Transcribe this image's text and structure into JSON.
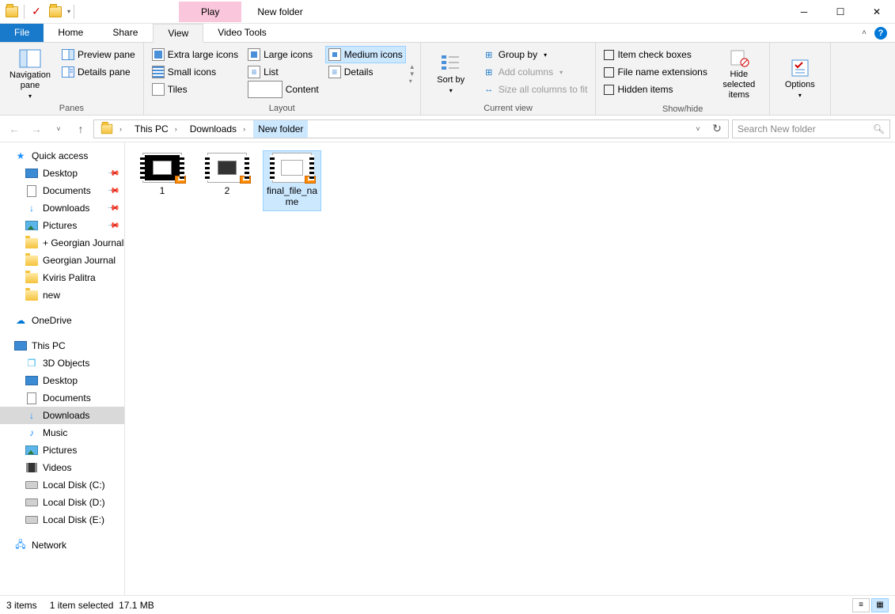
{
  "title": "New folder",
  "context_tab": "Play",
  "tabs": {
    "file": "File",
    "home": "Home",
    "share": "Share",
    "view": "View",
    "video": "Video Tools"
  },
  "ribbon": {
    "panes": {
      "nav": "Navigation pane",
      "preview": "Preview pane",
      "details": "Details pane",
      "label": "Panes"
    },
    "layout": {
      "xl": "Extra large icons",
      "lg": "Large icons",
      "md": "Medium icons",
      "sm": "Small icons",
      "list": "List",
      "details": "Details",
      "tiles": "Tiles",
      "content": "Content",
      "label": "Layout"
    },
    "currentview": {
      "sort": "Sort by",
      "group": "Group by",
      "addcols": "Add columns",
      "sizecols": "Size all columns to fit",
      "label": "Current view"
    },
    "showhide": {
      "chk": "Item check boxes",
      "ext": "File name extensions",
      "hidden": "Hidden items",
      "hidesel": "Hide selected items",
      "label": "Show/hide"
    },
    "options": "Options"
  },
  "breadcrumb": {
    "pc": "This PC",
    "dl": "Downloads",
    "nf": "New folder"
  },
  "search_placeholder": "Search New folder",
  "tree": {
    "quick": "Quick access",
    "desktop": "Desktop",
    "documents": "Documents",
    "downloads": "Downloads",
    "pictures": "Pictures",
    "gj1": "+ Georgian Journal",
    "gj2": "Georgian Journal",
    "kp": "Kviris Palitra",
    "new": "new",
    "onedrive": "OneDrive",
    "thispc": "This PC",
    "3d": "3D Objects",
    "music": "Music",
    "videos": "Videos",
    "diskC": "Local Disk (C:)",
    "diskD": "Local Disk (D:)",
    "diskE": "Local Disk (E:)",
    "network": "Network"
  },
  "files": {
    "f1": "1",
    "f2": "2",
    "f3": "final_file_name"
  },
  "status": {
    "count": "3 items",
    "sel": "1 item selected",
    "size": "17.1 MB"
  }
}
